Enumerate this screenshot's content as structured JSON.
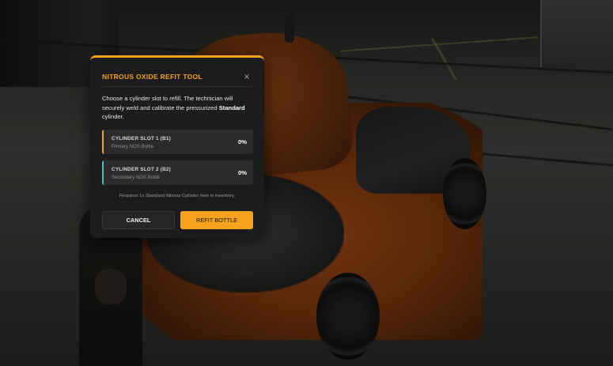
{
  "modal": {
    "title": "NITROUS OXIDE REFIT TOOL",
    "close_icon": "×",
    "description": {
      "before": "Choose a cylinder slot to refill. The technician will securely weld and calibrate the pressurized ",
      "emphasis": "Standard",
      "after": " cylinder."
    },
    "slots": [
      {
        "name": "CYLINDER SLOT 1 (B1)",
        "subtitle": "Primary NOS Bottle",
        "fill": "0%",
        "accent": "#f5a31c"
      },
      {
        "name": "CYLINDER SLOT 2 (B2)",
        "subtitle": "Secondary NOS Bottle",
        "fill": "0%",
        "accent": "#2fc7c0"
      }
    ],
    "requirement": "Requires 1x Standard Nitrous Cylinder item in inventory.",
    "cancel_label": "CANCEL",
    "refit_label": "REFIT BOTTLE"
  },
  "colors": {
    "accent": "#f5a31c",
    "teal": "#2fc7c0",
    "panel": "#1c1c1c",
    "slot_bg": "#2b2b2b"
  }
}
